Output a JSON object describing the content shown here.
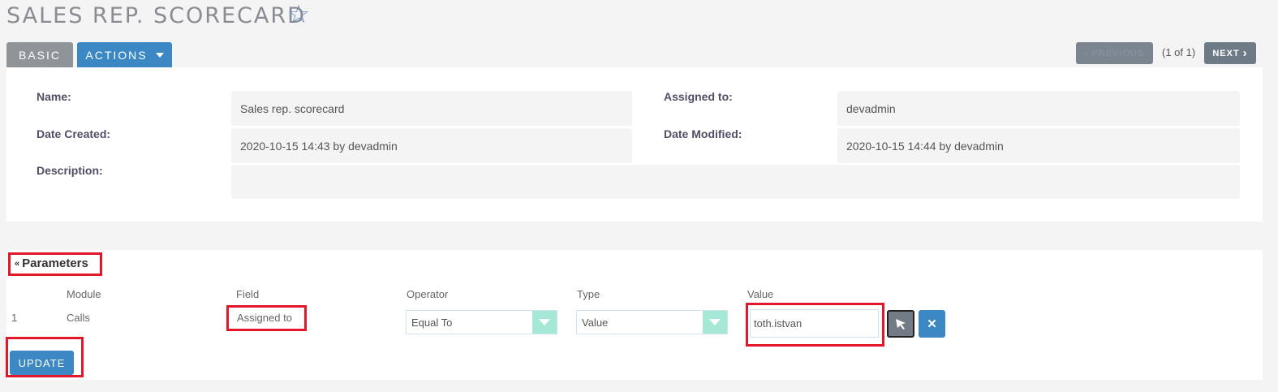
{
  "header": {
    "title": "SALES REP. SCORECARD",
    "favorite_icon": "star-outline-icon"
  },
  "tabs": {
    "basic": "BASIC",
    "actions": "ACTIONS"
  },
  "pagination": {
    "previous": "PREVIOUS",
    "status": "(1 of 1)",
    "next": "NEXT"
  },
  "details": {
    "name_label": "Name:",
    "name_value": "Sales rep. scorecard",
    "assigned_label": "Assigned to:",
    "assigned_value": "devadmin",
    "created_label": "Date Created:",
    "created_value": "2020-10-15 14:43 by devadmin",
    "modified_label": "Date Modified:",
    "modified_value": "2020-10-15 14:44 by devadmin",
    "description_label": "Description:",
    "description_value": ""
  },
  "parameters": {
    "title": "Parameters",
    "columns": {
      "module": "Module",
      "field": "Field",
      "operator": "Operator",
      "type": "Type",
      "value": "Value"
    },
    "row": {
      "index": "1",
      "module": "Calls",
      "field": "Assigned to",
      "operator": "Equal To",
      "type": "Value",
      "value": "toth.istvan"
    },
    "update_label": "UPDATE"
  },
  "colors": {
    "accent": "#3b88c4",
    "highlight": "#e2172a",
    "select_arrow": "#a5e8d6"
  }
}
